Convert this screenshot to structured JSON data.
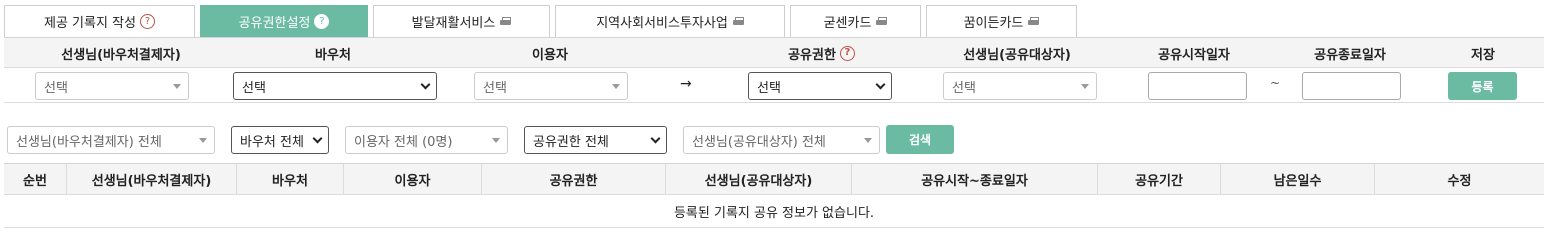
{
  "tabs": [
    {
      "label": "제공 기록지 작성",
      "icon": "help-icon"
    },
    {
      "label": "공유권한설정",
      "icon": "help-icon",
      "active": true
    },
    {
      "label": "발달재활서비스",
      "icon": "printer-icon"
    },
    {
      "label": "지역사회서비스투자사업",
      "icon": "printer-icon"
    },
    {
      "label": "굳센카드",
      "icon": "printer-icon"
    },
    {
      "label": "꿈이든카드",
      "icon": "printer-icon"
    }
  ],
  "form": {
    "headers": {
      "payer_teacher": "선생님(바우처결제자)",
      "voucher": "바우처",
      "user": "이용자",
      "permission": "공유권한",
      "target_teacher": "선생님(공유대상자)",
      "start_date": "공유시작일자",
      "end_date": "공유종료일자",
      "save": "저장"
    },
    "payer_teacher_value": "선택",
    "voucher_value": "선택",
    "user_value": "선택",
    "arrow": "→",
    "permission_value": "선택",
    "target_teacher_value": "선택",
    "start_date_value": "",
    "tilde": "~",
    "end_date_value": "",
    "register_label": "등록"
  },
  "search": {
    "payer_teacher": "선생님(바우처결제자) 전체",
    "voucher": "바우처 전체",
    "user": "이용자 전체 (0명)",
    "permission": "공유권한 전체",
    "target_teacher": "선생님(공유대상자) 전체",
    "search_label": "검색"
  },
  "table": {
    "columns": [
      "순번",
      "선생님(바우처결제자)",
      "바우처",
      "이용자",
      "공유권한",
      "선생님(공유대상자)",
      "공유시작~종료일자",
      "공유기간",
      "남은일수",
      "수정"
    ],
    "empty_message": "등록된 기록지 공유 정보가 없습니다."
  },
  "colors": {
    "accent": "#6bbba3",
    "help_icon": "#c0504d"
  }
}
